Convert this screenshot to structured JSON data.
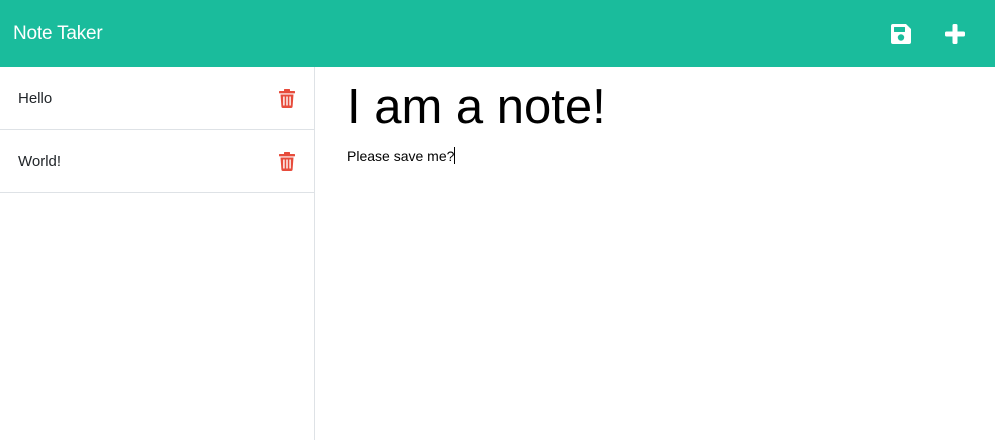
{
  "app": {
    "title": "Note Taker"
  },
  "toolbar": {
    "save_icon": "save-icon",
    "new_icon": "plus-icon"
  },
  "colors": {
    "navbar": "#1abc9c",
    "delete": "#e74c3c",
    "divider": "#dee2e6"
  },
  "sidebar": {
    "notes": [
      {
        "title": "Hello",
        "delete_icon": "trash-icon"
      },
      {
        "title": "World!",
        "delete_icon": "trash-icon"
      }
    ]
  },
  "editor": {
    "title_value": "I am a note!",
    "body_value": "Please save me?"
  }
}
